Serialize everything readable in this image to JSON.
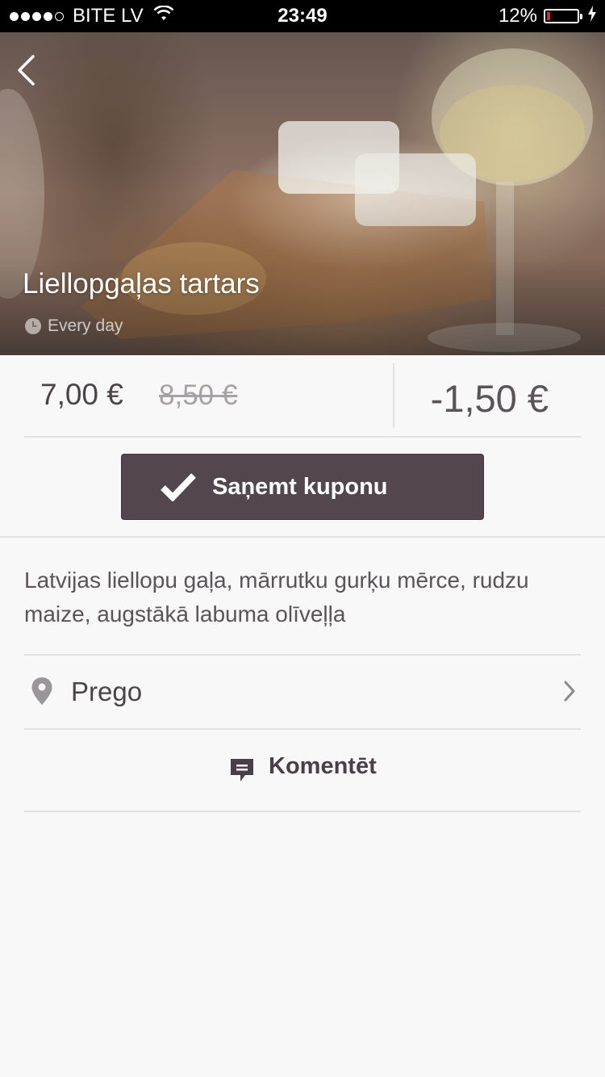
{
  "status_bar": {
    "carrier": "BITE LV",
    "time": "23:49",
    "battery_percent": "12%",
    "battery_level": 0.12,
    "signal_bars": 4
  },
  "hero": {
    "title": "Liellopgaļas tartars",
    "schedule": "Every day",
    "back_icon": "chevron-left-icon"
  },
  "pricing": {
    "price": "7,00 €",
    "old_price": "8,50 €",
    "discount": "-1,50 €"
  },
  "coupon": {
    "label": "Saņemt kuponu",
    "icon": "checkmark-icon"
  },
  "description": "Latvijas liellopu gaļa, mārrutku gurķu mērce, rudzu maize, augstākā labuma olīveļļa",
  "place": {
    "name": "Prego",
    "icon": "location-pin-icon"
  },
  "comment": {
    "label": "Komentēt",
    "icon": "comment-icon"
  },
  "colors": {
    "accent": "#53464f",
    "background": "#f8f8f8"
  }
}
